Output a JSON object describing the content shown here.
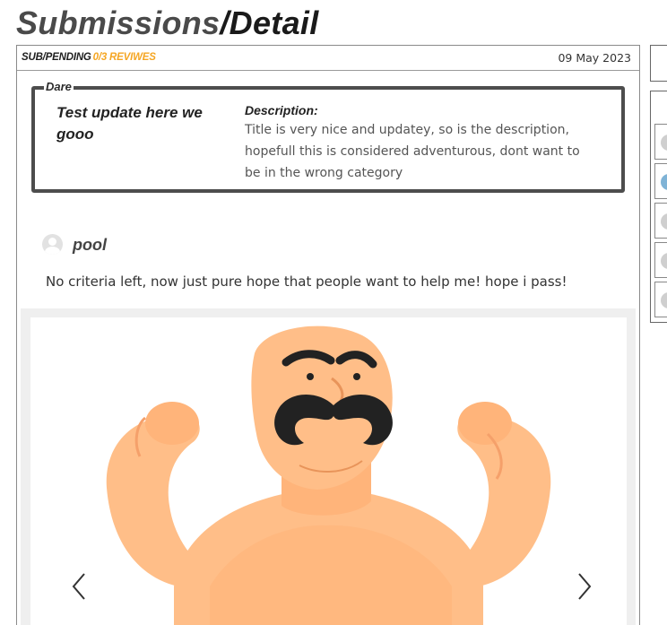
{
  "page": {
    "title_part1": "Submissions",
    "title_separator": "/",
    "title_part2": "Detail"
  },
  "submission": {
    "status_prefix": "SUB/PENDING",
    "reviews": "0/3 REVIWES",
    "date": "09 May 2023",
    "dare": {
      "legend": "Dare",
      "title": "Test update here we gooo",
      "description_label": "Description:",
      "description": "Title is very nice and updatey, so is the description, hopefull this is considered adventurous, dont want to be in the wrong category"
    },
    "author": {
      "name": "pool"
    },
    "comment": "No criteria left, now just pure hope that people want to help me! hope i pass!",
    "image": {
      "icon": "strongman-illustration"
    },
    "carousel": {
      "prev_icon": "chevron-left-icon",
      "next_icon": "chevron-right-icon"
    }
  },
  "colors": {
    "accent": "#f5a623",
    "border_dark": "#4d4d4d",
    "panel_bg": "#efefef",
    "skin": "#ffbe88",
    "mustache": "#222222"
  }
}
